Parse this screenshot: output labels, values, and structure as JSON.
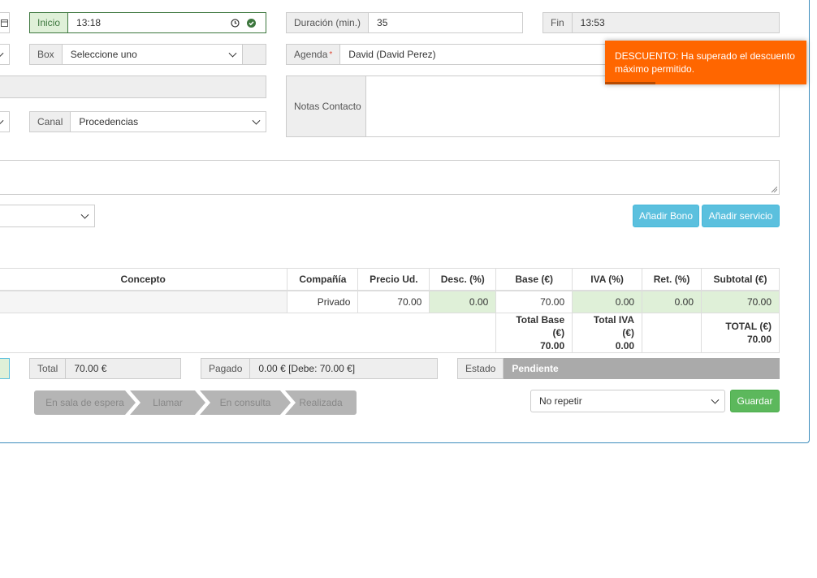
{
  "row1": {
    "inicio_label": "Inicio",
    "inicio_value": "13:18",
    "duracion_label": "Duración (min.)",
    "duracion_value": "35",
    "fin_label": "Fin",
    "fin_value": "13:53"
  },
  "row2": {
    "box_label": "Box",
    "box_value": "Seleccione uno",
    "agenda_label": "Agenda",
    "agenda_required": "*",
    "agenda_value": "David (David Perez)"
  },
  "row3": {
    "notas_label": "Notas Contacto",
    "notas_value": ""
  },
  "row4": {
    "canal_label": "Canal",
    "canal_value": "Procedencias"
  },
  "buttons": {
    "add_bono": "Añadir Bono",
    "add_servicio": "Añadir servicio",
    "guardar": "Guardar"
  },
  "table": {
    "headers": [
      "Concepto",
      "Compañía",
      "Precio Ud.",
      "Desc. (%)",
      "Base (€)",
      "IVA (%)",
      "Ret. (%)",
      "Subtotal (€)"
    ],
    "row": {
      "concepto": "",
      "compania": "Privado",
      "precio": "70.00",
      "desc": "0.00",
      "base": "70.00",
      "iva": "0.00",
      "ret": "0.00",
      "subtotal": "70.00"
    },
    "totals": {
      "base_label": "Total Base (€)",
      "base_value": "70.00",
      "iva_label": "Total IVA (€)",
      "iva_value": "0.00",
      "total_label": "TOTAL (€)",
      "total_value": "70.00"
    }
  },
  "summary": {
    "total_label": "Total",
    "total_value": "70.00 €",
    "pagado_label": "Pagado",
    "pagado_value": "0.00 € [Debe: 70.00 €]",
    "estado_label": "Estado",
    "estado_value": "Pendiente"
  },
  "steps": [
    "En sala de espera",
    "Llamar",
    "En consulta",
    "Realizada"
  ],
  "repeat_select": "No repetir",
  "toast": {
    "message": "DESCUENTO: Ha superado el descuento máximo permitido."
  },
  "colors": {
    "toast": "#ff6600",
    "info_button": "#5bc0de",
    "success_button": "#5cb85c",
    "estado_bg": "#aaaaaa",
    "valid_green": "#dff0d8"
  }
}
